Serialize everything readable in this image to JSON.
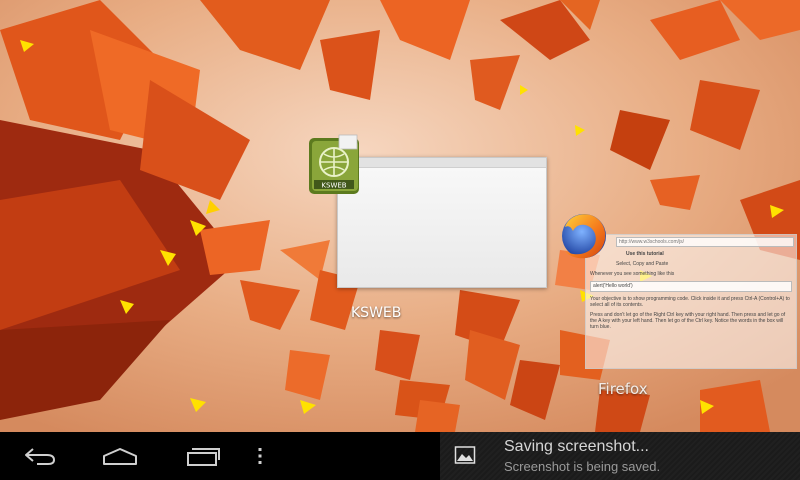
{
  "recents": {
    "kweb": {
      "label": "KSWEB",
      "icon": "ksweb-app-icon",
      "icon_text": "KSWEB"
    },
    "firefox": {
      "label": "Firefox",
      "icon": "firefox-app-icon",
      "thumb": {
        "url": "http://www.w3schools.com/js/",
        "line1": "Use this tutorial",
        "line2": "Select, Copy and Paste",
        "line3": "Whenever you see something like this",
        "box": "alert('Hello world')",
        "para1": "Your objective is to show programming code. Click inside it and press Ctrl-A (Control+A) to select all of its contents.",
        "para2": "Press and don't let go of the Right Ctrl key with your right hand. Then press and let go of the A key with your left hand. Then let go of the Ctrl key. Notice the words in the box will turn blue."
      }
    }
  },
  "navbar": {
    "back_icon": "back-icon",
    "home_icon": "home-icon",
    "recents_icon": "recent-apps-icon",
    "menu_icon": "overflow-menu-icon"
  },
  "notification": {
    "icon": "image-icon",
    "title": "Saving screenshot...",
    "subtitle": "Screenshot is being saved."
  },
  "colors": {
    "wallpaper_bg": "#e9b48d",
    "shard_orange": "#e0561b",
    "shard_yellow": "#ffe100",
    "bar_bg": "#000000"
  }
}
